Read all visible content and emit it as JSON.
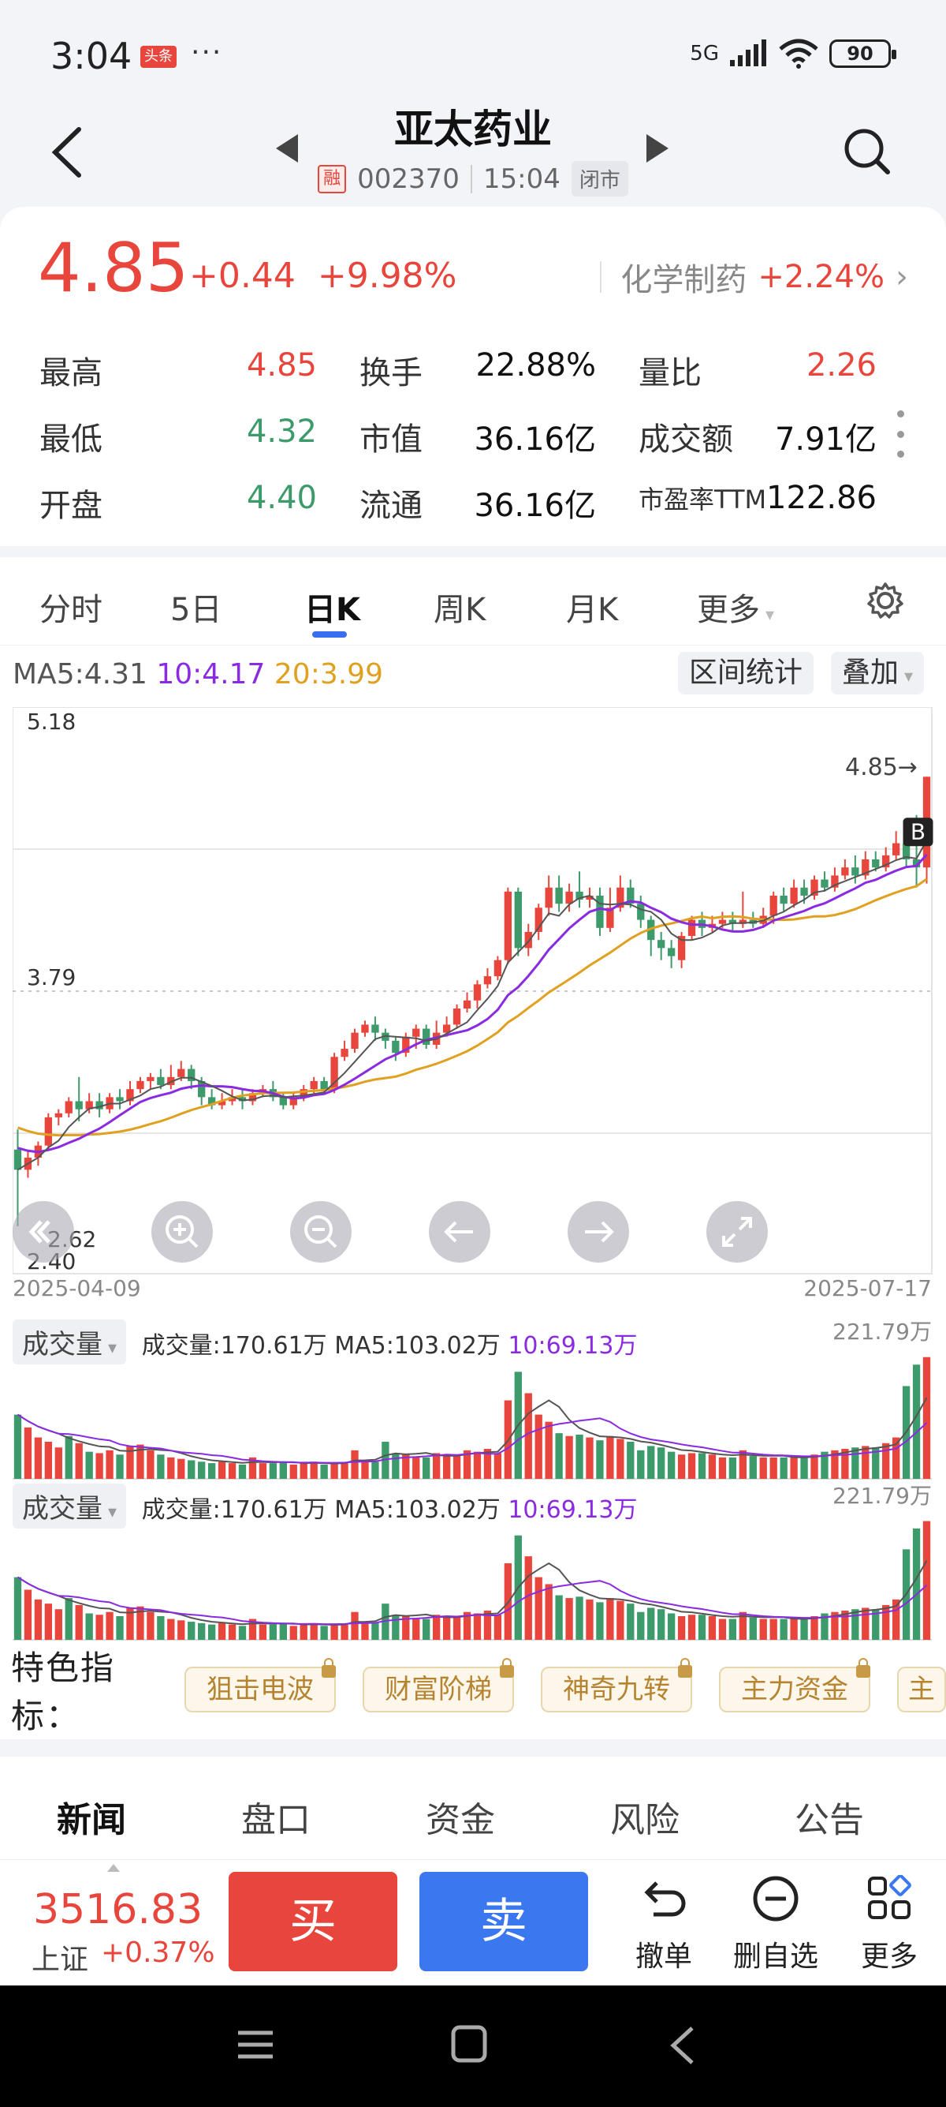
{
  "status_bar": {
    "time": "3:04",
    "badge": "头条",
    "dots": "···",
    "network": "5G",
    "battery": "90"
  },
  "header": {
    "title": "亚太药业",
    "rong_label": "融",
    "code": "002370",
    "time": "15:04",
    "market_status": "闭市"
  },
  "quote": {
    "price": "4.85",
    "change": "+0.44",
    "change_pct": "+9.98%",
    "sector_name": "化学制药",
    "sector_change": "+2.24%",
    "stats": [
      [
        {
          "label": "最高",
          "value": "4.85",
          "color": "red"
        },
        {
          "label": "换手",
          "value": "22.88%",
          "color": "dark"
        },
        {
          "label": "量比",
          "value": "2.26",
          "color": "red"
        }
      ],
      [
        {
          "label": "最低",
          "value": "4.32",
          "color": "green"
        },
        {
          "label": "市值",
          "value": "36.16亿",
          "color": "dark"
        },
        {
          "label": "成交额",
          "value": "7.91亿",
          "color": "dark"
        }
      ],
      [
        {
          "label": "开盘",
          "value": "4.40",
          "color": "green"
        },
        {
          "label": "流通",
          "value": "36.16亿",
          "color": "dark"
        },
        {
          "label": "市盈率TTM",
          "value": "122.86",
          "color": "dark"
        }
      ]
    ]
  },
  "tabs": [
    "分时",
    "5日",
    "日K",
    "周K",
    "月K",
    "更多"
  ],
  "active_tab": "日K",
  "ma_line": {
    "ma5": "MA5:4.31",
    "ma10": "10:4.17",
    "ma20": "20:3.99"
  },
  "chart_buttons": {
    "range_stats": "区间统计",
    "overlay": "叠加"
  },
  "chart_data": {
    "type": "candlestick",
    "y_max_label": "5.18",
    "y_mid_label": "3.79",
    "y_min_label": "2.40",
    "low_mark": "2.62",
    "last_mark": "4.85→",
    "buy_marker": "B",
    "start_date": "2025-04-09",
    "end_date": "2025-07-17",
    "ylim": [
      2.4,
      5.18
    ],
    "candles": [
      [
        3.0,
        2.9,
        3.1,
        2.62
      ],
      [
        2.9,
        2.96,
        3.0,
        2.86
      ],
      [
        2.96,
        3.02,
        3.04,
        2.92
      ],
      [
        3.02,
        3.16,
        3.18,
        3.0
      ],
      [
        3.16,
        3.18,
        3.2,
        3.12
      ],
      [
        3.18,
        3.24,
        3.26,
        3.16
      ],
      [
        3.24,
        3.2,
        3.36,
        3.14
      ],
      [
        3.2,
        3.24,
        3.28,
        3.18
      ],
      [
        3.24,
        3.2,
        3.28,
        3.16
      ],
      [
        3.2,
        3.26,
        3.28,
        3.18
      ],
      [
        3.26,
        3.24,
        3.3,
        3.2
      ],
      [
        3.24,
        3.3,
        3.34,
        3.22
      ],
      [
        3.3,
        3.34,
        3.36,
        3.28
      ],
      [
        3.34,
        3.36,
        3.38,
        3.3
      ],
      [
        3.36,
        3.32,
        3.4,
        3.3
      ],
      [
        3.32,
        3.36,
        3.42,
        3.3
      ],
      [
        3.36,
        3.4,
        3.44,
        3.34
      ],
      [
        3.4,
        3.34,
        3.42,
        3.3
      ],
      [
        3.34,
        3.26,
        3.36,
        3.22
      ],
      [
        3.26,
        3.22,
        3.3,
        3.2
      ],
      [
        3.22,
        3.24,
        3.28,
        3.2
      ],
      [
        3.24,
        3.26,
        3.3,
        3.22
      ],
      [
        3.26,
        3.24,
        3.3,
        3.2
      ],
      [
        3.24,
        3.28,
        3.3,
        3.22
      ],
      [
        3.28,
        3.3,
        3.32,
        3.26
      ],
      [
        3.3,
        3.26,
        3.34,
        3.24
      ],
      [
        3.26,
        3.22,
        3.28,
        3.2
      ],
      [
        3.22,
        3.26,
        3.28,
        3.2
      ],
      [
        3.26,
        3.3,
        3.32,
        3.24
      ],
      [
        3.3,
        3.34,
        3.36,
        3.28
      ],
      [
        3.34,
        3.3,
        3.36,
        3.28
      ],
      [
        3.3,
        3.46,
        3.48,
        3.28
      ],
      [
        3.46,
        3.5,
        3.54,
        3.44
      ],
      [
        3.5,
        3.58,
        3.6,
        3.48
      ],
      [
        3.58,
        3.62,
        3.64,
        3.56
      ],
      [
        3.62,
        3.58,
        3.66,
        3.54
      ],
      [
        3.58,
        3.54,
        3.6,
        3.5
      ],
      [
        3.54,
        3.48,
        3.56,
        3.44
      ],
      [
        3.48,
        3.56,
        3.58,
        3.46
      ],
      [
        3.56,
        3.6,
        3.62,
        3.5
      ],
      [
        3.6,
        3.52,
        3.62,
        3.5
      ],
      [
        3.52,
        3.58,
        3.64,
        3.5
      ],
      [
        3.58,
        3.62,
        3.66,
        3.56
      ],
      [
        3.62,
        3.7,
        3.72,
        3.6
      ],
      [
        3.7,
        3.74,
        3.78,
        3.68
      ],
      [
        3.74,
        3.82,
        3.84,
        3.7
      ],
      [
        3.82,
        3.86,
        3.9,
        3.8
      ],
      [
        3.86,
        3.94,
        3.96,
        3.84
      ],
      [
        3.94,
        4.28,
        4.3,
        3.92
      ],
      [
        4.28,
        4.0,
        4.3,
        3.96
      ],
      [
        4.0,
        4.08,
        4.12,
        3.96
      ],
      [
        4.08,
        4.2,
        4.22,
        4.04
      ],
      [
        4.2,
        4.3,
        4.36,
        4.16
      ],
      [
        4.3,
        4.22,
        4.36,
        4.18
      ],
      [
        4.22,
        4.28,
        4.32,
        4.18
      ],
      [
        4.28,
        4.24,
        4.38,
        4.2
      ],
      [
        4.24,
        4.26,
        4.3,
        4.2
      ],
      [
        4.26,
        4.1,
        4.3,
        4.06
      ],
      [
        4.1,
        4.2,
        4.3,
        4.08
      ],
      [
        4.2,
        4.3,
        4.36,
        4.18
      ],
      [
        4.3,
        4.22,
        4.34,
        4.2
      ],
      [
        4.22,
        4.14,
        4.26,
        4.1
      ],
      [
        4.14,
        4.04,
        4.16,
        3.96
      ],
      [
        4.04,
        4.0,
        4.08,
        3.94
      ],
      [
        4.0,
        3.96,
        4.04,
        3.9
      ],
      [
        3.94,
        4.06,
        4.08,
        3.9
      ],
      [
        4.06,
        4.14,
        4.16,
        4.04
      ],
      [
        4.14,
        4.1,
        4.18,
        4.06
      ],
      [
        4.1,
        4.12,
        4.16,
        4.08
      ],
      [
        4.12,
        4.14,
        4.18,
        4.1
      ],
      [
        4.14,
        4.12,
        4.18,
        4.08
      ],
      [
        4.12,
        4.14,
        4.28,
        4.1
      ],
      [
        4.14,
        4.12,
        4.18,
        4.1
      ],
      [
        4.12,
        4.16,
        4.2,
        4.1
      ],
      [
        4.16,
        4.26,
        4.28,
        4.12
      ],
      [
        4.26,
        4.22,
        4.3,
        4.18
      ],
      [
        4.22,
        4.3,
        4.34,
        4.2
      ],
      [
        4.3,
        4.26,
        4.34,
        4.22
      ],
      [
        4.26,
        4.34,
        4.36,
        4.24
      ],
      [
        4.34,
        4.3,
        4.38,
        4.28
      ],
      [
        4.3,
        4.36,
        4.4,
        4.28
      ],
      [
        4.36,
        4.4,
        4.44,
        4.34
      ],
      [
        4.4,
        4.36,
        4.46,
        4.32
      ],
      [
        4.36,
        4.44,
        4.48,
        4.34
      ],
      [
        4.44,
        4.4,
        4.48,
        4.38
      ],
      [
        4.4,
        4.46,
        4.5,
        4.38
      ],
      [
        4.46,
        4.52,
        4.58,
        4.44
      ],
      [
        4.52,
        4.44,
        4.54,
        4.4
      ],
      [
        4.44,
        4.4,
        4.66,
        4.3
      ],
      [
        4.4,
        4.85,
        4.85,
        4.32
      ]
    ],
    "volume_panels": [
      {
        "label": "成交量",
        "summary": "成交量:170.61万 MA5:103.02万",
        "ma10": "10:69.13万",
        "max_label": "221.79万",
        "values": [
          90,
          72,
          58,
          52,
          44,
          60,
          50,
          38,
          36,
          40,
          34,
          46,
          48,
          40,
          34,
          30,
          28,
          26,
          24,
          22,
          24,
          22,
          20,
          30,
          22,
          22,
          24,
          20,
          22,
          24,
          20,
          22,
          22,
          40,
          26,
          24,
          52,
          36,
          34,
          30,
          30,
          36,
          32,
          34,
          40,
          38,
          42,
          36,
          110,
          150,
          120,
          90,
          80,
          64,
          60,
          62,
          58,
          54,
          60,
          56,
          52,
          40,
          46,
          44,
          38,
          34,
          36,
          36,
          34,
          30,
          30,
          40,
          32,
          30,
          30,
          30,
          30,
          30,
          34,
          38,
          40,
          42,
          44,
          46,
          44,
          50,
          58,
          130,
          160,
          170.61
        ],
        "up": [
          0,
          1,
          1,
          1,
          1,
          0,
          1,
          0,
          1,
          1,
          0,
          1,
          1,
          1,
          0,
          1,
          1,
          0,
          0,
          0,
          1,
          1,
          0,
          1,
          1,
          0,
          0,
          1,
          1,
          1,
          0,
          1,
          1,
          1,
          1,
          0,
          0,
          0,
          1,
          1,
          0,
          1,
          1,
          1,
          1,
          1,
          1,
          1,
          1,
          0,
          1,
          1,
          1,
          0,
          1,
          0,
          1,
          0,
          1,
          1,
          0,
          0,
          0,
          0,
          0,
          1,
          1,
          0,
          1,
          1,
          0,
          1,
          0,
          1,
          1,
          0,
          1,
          0,
          1,
          0,
          1,
          1,
          0,
          1,
          0,
          1,
          1,
          0,
          0,
          1
        ]
      },
      {
        "label": "成交量",
        "summary": "成交量:170.61万 MA5:103.02万",
        "ma10": "10:69.13万",
        "max_label": "221.79万",
        "values": [
          90,
          72,
          58,
          52,
          44,
          60,
          50,
          38,
          36,
          40,
          34,
          46,
          48,
          40,
          34,
          30,
          28,
          26,
          24,
          22,
          24,
          22,
          20,
          30,
          22,
          22,
          24,
          20,
          22,
          24,
          20,
          22,
          22,
          40,
          26,
          24,
          52,
          36,
          34,
          30,
          30,
          36,
          32,
          34,
          40,
          38,
          42,
          36,
          110,
          150,
          120,
          90,
          80,
          64,
          60,
          62,
          58,
          54,
          60,
          56,
          52,
          40,
          46,
          44,
          38,
          34,
          36,
          36,
          34,
          30,
          30,
          40,
          32,
          30,
          30,
          30,
          30,
          30,
          34,
          38,
          40,
          42,
          44,
          46,
          44,
          50,
          58,
          130,
          160,
          170.61
        ],
        "up": [
          0,
          1,
          1,
          1,
          1,
          0,
          1,
          0,
          1,
          1,
          0,
          1,
          1,
          1,
          0,
          1,
          1,
          0,
          0,
          0,
          1,
          1,
          0,
          1,
          1,
          0,
          0,
          1,
          1,
          1,
          0,
          1,
          1,
          1,
          1,
          0,
          0,
          0,
          1,
          1,
          0,
          1,
          1,
          1,
          1,
          1,
          1,
          1,
          1,
          0,
          1,
          1,
          1,
          0,
          1,
          0,
          1,
          0,
          1,
          1,
          0,
          0,
          0,
          0,
          0,
          1,
          1,
          0,
          1,
          1,
          0,
          1,
          0,
          1,
          1,
          0,
          1,
          0,
          1,
          0,
          1,
          1,
          0,
          1,
          0,
          1,
          1,
          0,
          0,
          1
        ]
      }
    ]
  },
  "features": {
    "label": "特色指标：",
    "items": [
      "狙击电波",
      "财富阶梯",
      "神奇九转",
      "主力资金",
      "主"
    ]
  },
  "bottom_tabs": [
    "新闻",
    "盘口",
    "资金",
    "风险",
    "公告"
  ],
  "action_bar": {
    "index_value": "3516.83",
    "index_name": "上证",
    "index_change": "+0.37%",
    "buy": "买",
    "sell": "卖",
    "actions": [
      "撤单",
      "删自选",
      "更多"
    ]
  },
  "colors": {
    "up": "#e8453c",
    "down": "#3d9a6a",
    "ma5": "#555555",
    "ma10": "#8a2be2",
    "ma20": "#e0a020",
    "accent": "#3a6df0",
    "sell": "#3b78f0"
  }
}
